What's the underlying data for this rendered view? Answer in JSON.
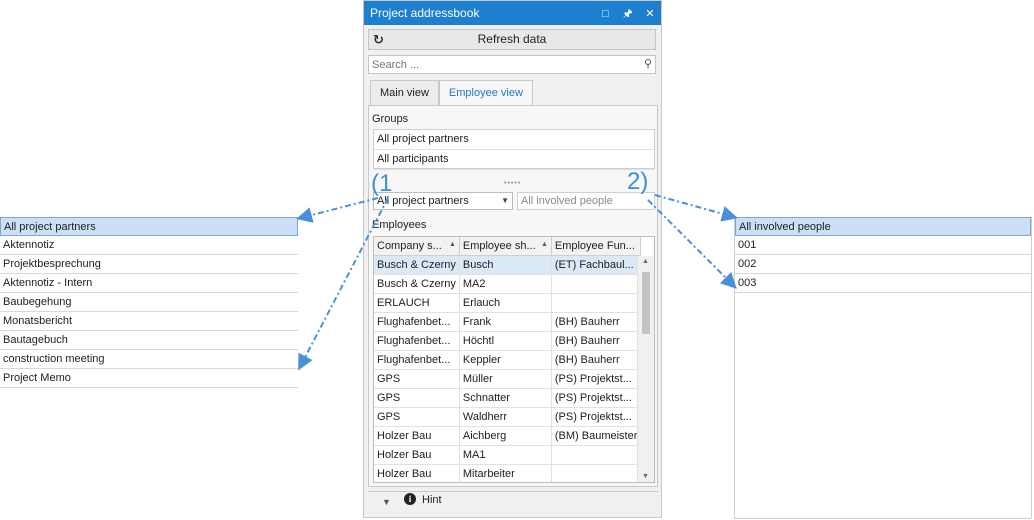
{
  "left_list": {
    "items": [
      "All project partners",
      "Aktennotiz",
      "Projektbesprechung",
      "Aktennotiz - Intern",
      "Baubegehung",
      "Monatsbericht",
      "Bautagebuch",
      "construction meeting",
      "Project Memo"
    ],
    "selected_index": 0
  },
  "right_list": {
    "items": [
      "All involved people",
      "001",
      "002",
      "003"
    ],
    "selected_index": 0
  },
  "panel": {
    "title": "Project addressbook",
    "title_icons": [
      "maximize-icon",
      "pin-icon",
      "close-icon"
    ],
    "refresh_label": "Refresh data",
    "search_placeholder": "Search ...",
    "tabs": [
      {
        "label": "Main view",
        "active": false
      },
      {
        "label": "Employee view",
        "active": true
      }
    ],
    "groups_label": "Groups",
    "groups": [
      "All project partners",
      "All participants"
    ],
    "filter_partner": "All project partners",
    "filter_people": "All involved people",
    "employees_label": "Employees",
    "columns": [
      "Company s...",
      "Employee sh...",
      "Employee Fun..."
    ],
    "rows": [
      [
        "Busch & Czerny",
        "Busch",
        "(ET) Fachbaul..."
      ],
      [
        "Busch & Czerny",
        "MA2",
        ""
      ],
      [
        "ERLAUCH",
        "Erlauch",
        ""
      ],
      [
        "Flughafenbet...",
        "Frank",
        "(BH) Bauherr"
      ],
      [
        "Flughafenbet...",
        "Höchtl",
        "(BH) Bauherr"
      ],
      [
        "Flughafenbet...",
        "Keppler",
        "(BH) Bauherr"
      ],
      [
        "GPS",
        "Müller",
        "(PS) Projektst..."
      ],
      [
        "GPS",
        "Schnatter",
        "(PS) Projektst..."
      ],
      [
        "GPS",
        "Waldherr",
        "(PS) Projektst..."
      ],
      [
        "Holzer Bau",
        "Aichberg",
        "(BM) Baumeister"
      ],
      [
        "Holzer Bau",
        "MA1",
        ""
      ],
      [
        "Holzer Bau",
        "Mitarbeiter",
        ""
      ]
    ],
    "selected_row": 0,
    "hint_label": "Hint"
  },
  "annotations": {
    "one": "(1",
    "two": "2)"
  },
  "colors": {
    "title_bar": "#1e7fd0",
    "arrow": "#4a90d9",
    "selection": "#cce0f5",
    "active_tab_text": "#1f78c8"
  }
}
